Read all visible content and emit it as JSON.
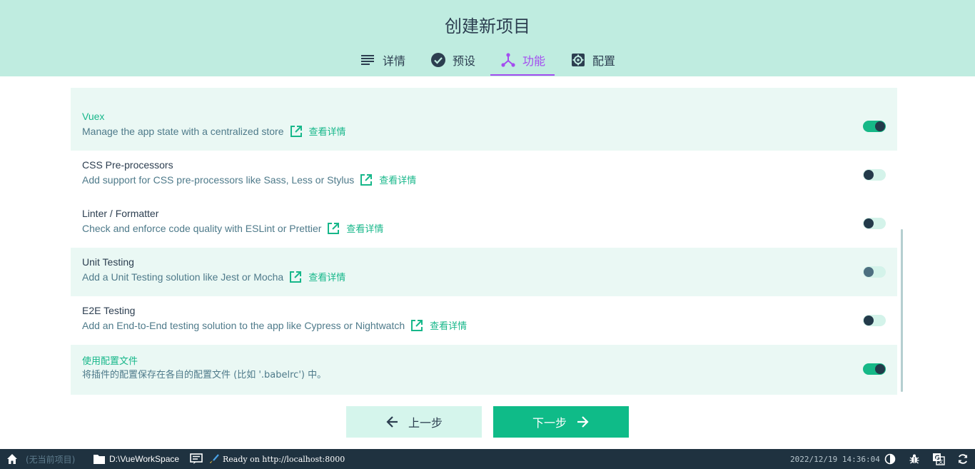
{
  "header": {
    "title": "创建新项目",
    "tabs": [
      {
        "label": "详情",
        "icon": "list-icon"
      },
      {
        "label": "预设",
        "icon": "check-circle-icon"
      },
      {
        "label": "功能",
        "icon": "feature-fork-icon",
        "active": true
      },
      {
        "label": "配置",
        "icon": "settings-gear-icon"
      }
    ]
  },
  "features": {
    "more_label": "查看详情",
    "items": [
      {
        "name": "Vuex",
        "desc": "Manage the app state with a centralized store",
        "enabled": true
      },
      {
        "name": "CSS Pre-processors",
        "desc": "Add support for CSS pre-processors like Sass, Less or Stylus",
        "enabled": false
      },
      {
        "name": "Linter / Formatter",
        "desc": "Check and enforce code quality with ESLint or Prettier",
        "enabled": false
      },
      {
        "name": "Unit Testing",
        "desc": "Add a Unit Testing solution like Jest or Mocha",
        "enabled": false
      },
      {
        "name": "E2E Testing",
        "desc": "Add an End-to-End testing solution to the app like Cypress or Nightwatch",
        "enabled": false
      },
      {
        "name": "使用配置文件",
        "desc": "将插件的配置保存在各自的配置文件 (比如 '.babelrc') 中。",
        "enabled": true
      }
    ]
  },
  "nav": {
    "prev_label": "上一步",
    "next_label": "下一步"
  },
  "statusbar": {
    "project": "(无当前项目)",
    "folder": "D:\\VueWorkSpace",
    "log": "Ready on http://localhost:8000",
    "datetime": "2022/12/19 14:36:04"
  },
  "colors": {
    "header_bg": "#bfece0",
    "accent_green": "#17b78a",
    "active_tab": "#a44cf0",
    "statusbar_bg": "#1f3240"
  }
}
